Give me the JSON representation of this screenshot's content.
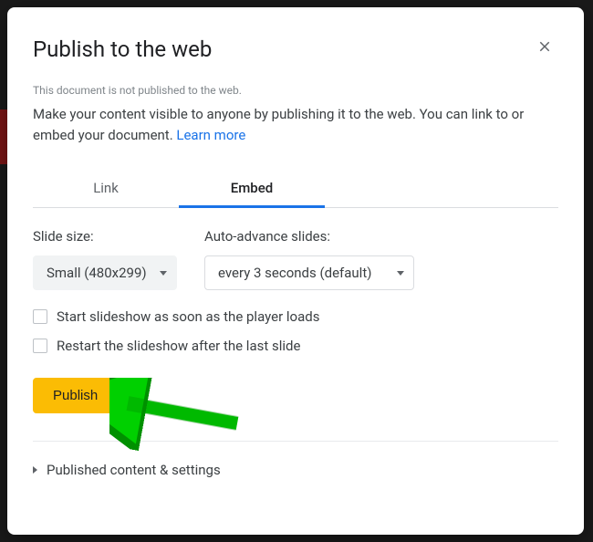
{
  "dialog": {
    "title": "Publish to the web",
    "status": "This document is not published to the web.",
    "description": "Make your content visible to anyone by publishing it to the web. You can link to or embed your document. ",
    "learn_more": "Learn more"
  },
  "tabs": {
    "link": "Link",
    "embed": "Embed"
  },
  "controls": {
    "slide_size_label": "Slide size:",
    "slide_size_value": "Small (480x299)",
    "auto_advance_label": "Auto-advance slides:",
    "auto_advance_value": "every 3 seconds (default)"
  },
  "checkboxes": {
    "start_slideshow": "Start slideshow as soon as the player loads",
    "restart_slideshow": "Restart the slideshow after the last slide"
  },
  "publish_button": "Publish",
  "expander": {
    "label": "Published content & settings"
  }
}
